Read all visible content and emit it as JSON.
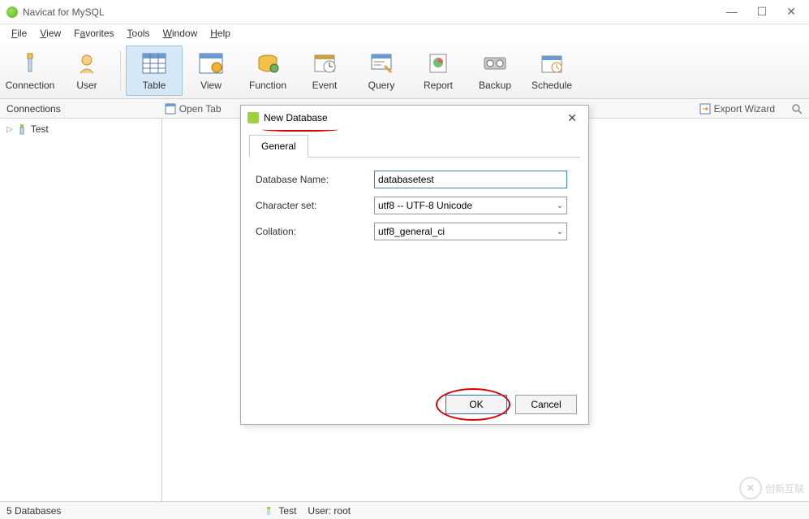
{
  "window": {
    "title": "Navicat for MySQL",
    "controls": {
      "min": "—",
      "max": "☐",
      "close": "✕"
    }
  },
  "menu": [
    "File",
    "View",
    "Favorites",
    "Tools",
    "Window",
    "Help"
  ],
  "toolbar": [
    {
      "label": "Connection",
      "icon": "connection"
    },
    {
      "label": "User",
      "icon": "user"
    },
    {
      "label": "Table",
      "icon": "table",
      "selected": true
    },
    {
      "label": "View",
      "icon": "view"
    },
    {
      "label": "Function",
      "icon": "function"
    },
    {
      "label": "Event",
      "icon": "event"
    },
    {
      "label": "Query",
      "icon": "query"
    },
    {
      "label": "Report",
      "icon": "report"
    },
    {
      "label": "Backup",
      "icon": "backup"
    },
    {
      "label": "Schedule",
      "icon": "schedule"
    }
  ],
  "secbar": {
    "panel": "Connections",
    "open_tab": "Open Tab",
    "export": "Export Wizard"
  },
  "sidebar": {
    "root": "Test"
  },
  "dialog": {
    "title": "New Database",
    "close": "✕",
    "tab": "General",
    "fields": {
      "db_name_label": "Database Name:",
      "db_name_value": "databasetest",
      "charset_label": "Character set:",
      "charset_value": "utf8 -- UTF-8 Unicode",
      "collation_label": "Collation:",
      "collation_value": "utf8_general_ci"
    },
    "buttons": {
      "ok": "OK",
      "cancel": "Cancel"
    }
  },
  "status": {
    "left": "5 Databases",
    "conn": "Test",
    "user": "User: root"
  },
  "watermark": "创新互联"
}
